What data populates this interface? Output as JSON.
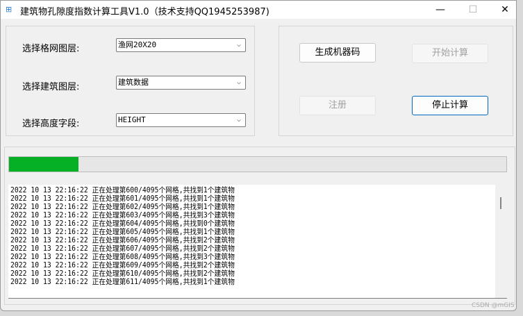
{
  "window": {
    "title": "建筑物孔隙度指数计算工具V1.0（技术支持QQ1945253987)",
    "minimize": "—",
    "maximize": "☐",
    "close": "✕",
    "app_icon": "app-grid-icon"
  },
  "form": {
    "grid_label": "选择格网图层:",
    "grid_value": "渔网20X20",
    "building_label": "选择建筑图层:",
    "building_value": "建筑数据",
    "height_label": "选择高度字段:",
    "height_value": "HEIGHT",
    "chevron": "⌵"
  },
  "buttons": {
    "machine_code": "生成机器码",
    "start": "开始计算",
    "register": "注册",
    "stop": "停止计算"
  },
  "progress": {
    "percent": 14
  },
  "log": {
    "lines": [
      "2022 10 13 22:16:22 正在处理第600/4095个网格,共找到1个建筑物",
      "2022 10 13 22:16:22 正在处理第601/4095个网格,共找到1个建筑物",
      "2022 10 13 22:16:22 正在处理第602/4095个网格,共找到1个建筑物",
      "2022 10 13 22:16:22 正在处理第603/4095个网格,共找到3个建筑物",
      "2022 10 13 22:16:22 正在处理第604/4095个网格,共找到0个建筑物",
      "2022 10 13 22:16:22 正在处理第605/4095个网格,共找到1个建筑物",
      "2022 10 13 22:16:22 正在处理第606/4095个网格,共找到2个建筑物",
      "2022 10 13 22:16:22 正在处理第607/4095个网格,共找到2个建筑物",
      "2022 10 13 22:16:22 正在处理第608/4095个网格,共找到3个建筑物",
      "2022 10 13 22:16:22 正在处理第609/4095个网格,共找到2个建筑物",
      "2022 10 13 22:16:22 正在处理第610/4095个网格,共找到2个建筑物",
      "2022 10 13 22:16:22 正在处理第611/4095个网格,共找到1个建筑物"
    ]
  },
  "watermark": "CSDN @mGIS"
}
